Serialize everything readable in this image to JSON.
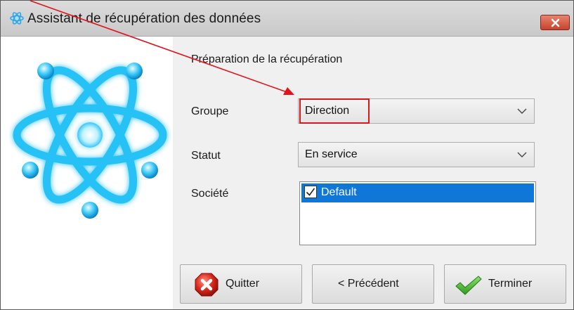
{
  "window": {
    "title": "Assistant de récupération des données",
    "close_glyph": "✕"
  },
  "wizard": {
    "heading": "Préparation de la récupération"
  },
  "form": {
    "groupe_label": "Groupe",
    "groupe_value": "Direction",
    "statut_label": "Statut",
    "statut_value": "En service",
    "societe_label": "Société",
    "societe_items": [
      {
        "label": "Default",
        "checked": true,
        "selected": true
      }
    ]
  },
  "buttons": {
    "quit_label": "Quitter",
    "prev_label": "< Précédent",
    "finish_label": "Terminer"
  },
  "colors": {
    "selection": "#0f77d7",
    "annotation": "#e0141c",
    "close": "#c7432b"
  },
  "icons": {
    "app": "atom-icon",
    "quit": "error-x-icon",
    "finish": "checkmark-icon",
    "dropdown": "chevron-down-icon"
  }
}
